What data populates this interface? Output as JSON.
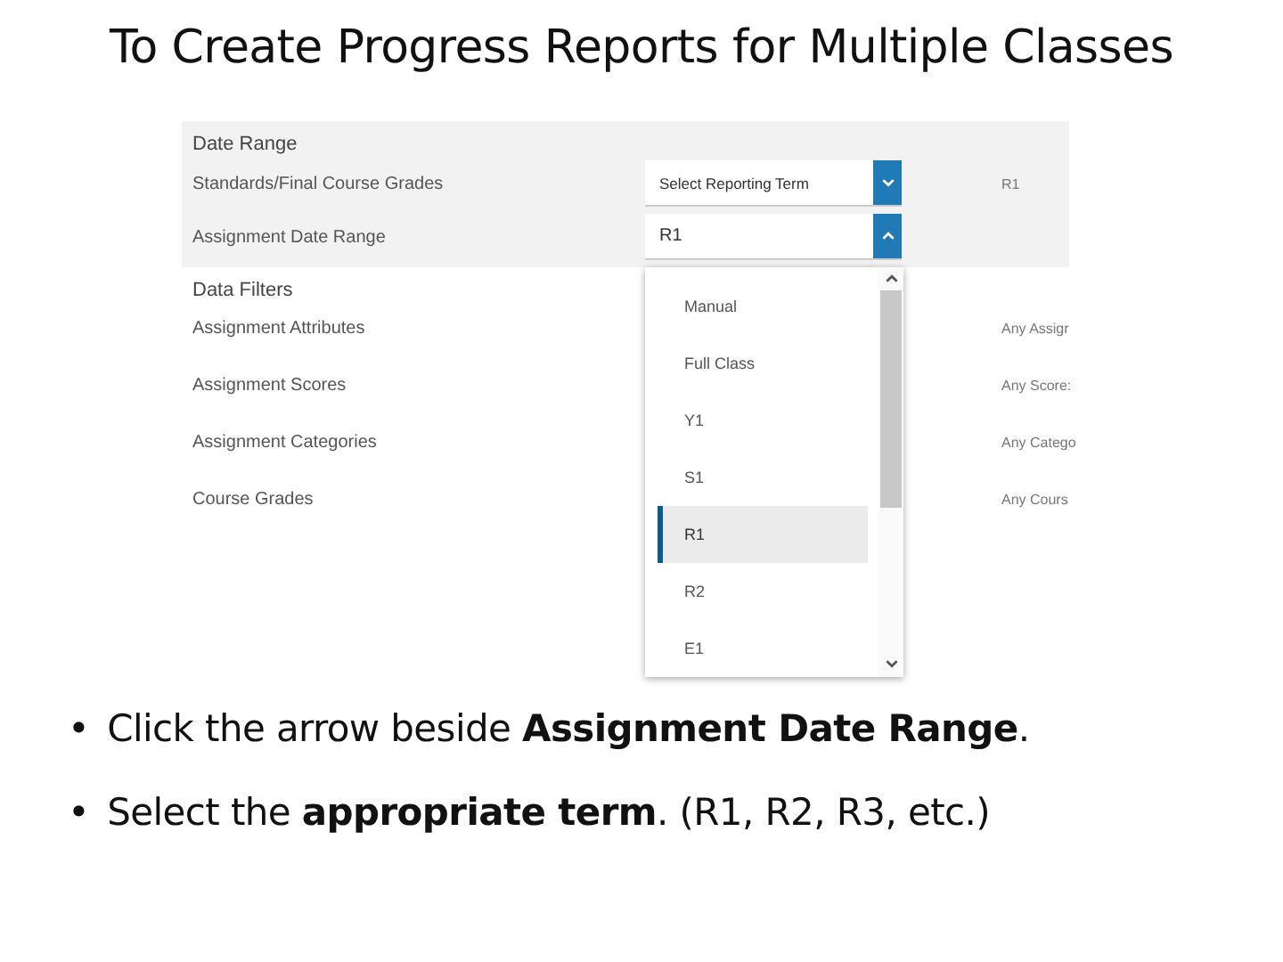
{
  "title": "To Create Progress Reports for Multiple Classes",
  "screenshot": {
    "sections": [
      {
        "heading": "Date Range",
        "shaded": true,
        "rows": [
          {
            "label": "Standards/Final Course Grades",
            "kind": "select",
            "value": "Select Reporting Term",
            "expanded": false,
            "right": "R1"
          },
          {
            "label": "Assignment Date Range",
            "kind": "select",
            "value": "R1",
            "expanded": true
          }
        ]
      },
      {
        "heading": "Data Filters",
        "shaded": false,
        "rows": [
          {
            "label": "Assignment Attributes",
            "kind": "text",
            "right": "Any Assigr"
          },
          {
            "label": "Assignment Scores",
            "kind": "text",
            "right": "Any Score:"
          },
          {
            "label": "Assignment Categories",
            "kind": "text",
            "right": "Any Catego"
          },
          {
            "label": "Course Grades",
            "kind": "text",
            "right": "Any Cours"
          }
        ]
      }
    ],
    "dropdown": {
      "options": [
        {
          "label": "Manual",
          "selected": false
        },
        {
          "label": "Full Class",
          "selected": false
        },
        {
          "label": "Y1",
          "selected": false
        },
        {
          "label": "S1",
          "selected": false
        },
        {
          "label": "R1",
          "selected": true
        },
        {
          "label": "R2",
          "selected": false
        },
        {
          "label": "E1",
          "selected": false
        }
      ]
    }
  },
  "bullets": [
    {
      "bullet": "•",
      "text": "Click the arrow beside **Assignment Date Range**."
    },
    {
      "bullet": "•",
      "text": "Select the **appropriate term**. (R1, R2, R3, etc.)"
    }
  ]
}
